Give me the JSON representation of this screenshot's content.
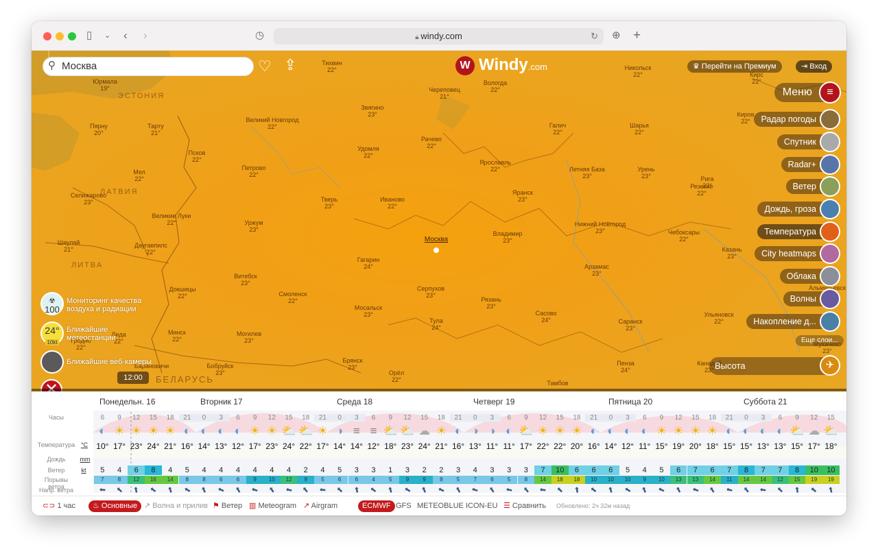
{
  "browser": {
    "url": "windy.com"
  },
  "map": {
    "search_value": "Москва",
    "logo_text": "Windy",
    "logo_domain": ".com",
    "premium": "Перейти на Премиум",
    "login": "Вход",
    "menu": "Меню",
    "layers": [
      "Радар погоды",
      "Спутник",
      "Radar+",
      "Ветер",
      "Дождь, гроза",
      "Температура",
      "City heatmaps",
      "Облака",
      "Волны",
      "Накопление д..."
    ],
    "more_layers": "Еще слои...",
    "altitude": "Высота",
    "time": "12:00",
    "air_quality_value": "100",
    "air_quality_label": "Мониторинг качества воздуха и радиации",
    "nearest_value": "24°",
    "nearest_sub": "10kt",
    "nearest_label": "Ближайшие метеостанции",
    "webcams_label": "Ближайшие веб-камеры",
    "countries": [
      "ЭСТОНИЯ",
      "ЛАТВИЯ",
      "ЛИТВА",
      "БЕЛАРУСЬ"
    ],
    "cities": [
      [
        "Тихвин",
        "22°"
      ],
      [
        "Череповец",
        "21°"
      ],
      [
        "Вологда",
        "22°"
      ],
      [
        "Никольск",
        "22°"
      ],
      [
        "Кирс",
        "22°"
      ],
      [
        "Пярну",
        "20°"
      ],
      [
        "Тарту",
        "21°"
      ],
      [
        "Великий Новгород",
        "22°"
      ],
      [
        "Звягино",
        "23°"
      ],
      [
        "Псков",
        "22°"
      ],
      [
        "Удомля",
        "22°"
      ],
      [
        "Рачево",
        "22°"
      ],
      [
        "Галич",
        "22°"
      ],
      [
        "Шарья",
        "22°"
      ],
      [
        "Киров",
        "22°"
      ],
      [
        "Мел",
        "22°"
      ],
      [
        "Петрово",
        "22°"
      ],
      [
        "Ярославль",
        "22°"
      ],
      [
        "Летняя База",
        "23°"
      ],
      [
        "Урень",
        "23°"
      ],
      [
        "Рига",
        "22°"
      ],
      [
        "Селижарово",
        "23°"
      ],
      [
        "Тверь",
        "23°"
      ],
      [
        "Иваново",
        "22°"
      ],
      [
        "Яранск",
        "23°"
      ],
      [
        "Резекне",
        "22°"
      ],
      [
        "Великие Луки",
        "22°"
      ],
      [
        "Уржум",
        "23°"
      ],
      [
        "Москва",
        ""
      ],
      [
        "Владимир",
        "23°"
      ],
      [
        "Нижний Новгород",
        "23°"
      ],
      [
        "Чебоксары",
        "22°"
      ],
      [
        "Шяуляй",
        "21°"
      ],
      [
        "Даугавпилс",
        "22°"
      ],
      [
        "Гагарин",
        "24°"
      ],
      [
        "Казань",
        "23°"
      ],
      [
        "Витебск",
        "23°"
      ],
      [
        "Арзамас",
        "23°"
      ],
      [
        "Серпухов",
        "23°"
      ],
      [
        "Докшицы",
        "22°"
      ],
      [
        "Смоленск",
        "22°"
      ],
      [
        "Рязань",
        "23°"
      ],
      [
        "Мосальск",
        "23°"
      ],
      [
        "Сасово",
        "24°"
      ],
      [
        "Тула",
        "24°"
      ],
      [
        "Ульяновск",
        "22°"
      ],
      [
        "Саранск",
        "23°"
      ],
      [
        "Минск",
        "22°"
      ],
      [
        "Могилев",
        "23°"
      ],
      [
        "Лида",
        "22°"
      ],
      [
        "Пенза",
        "24°"
      ],
      [
        "Брянск",
        "23°"
      ],
      [
        "Бобруйск",
        "23°"
      ],
      [
        "Канадей",
        "23°"
      ],
      [
        "Орёл",
        "22°"
      ],
      [
        "Барановичи",
        ""
      ],
      [
        "Тамбов",
        ""
      ],
      [
        "Альметьевск",
        ""
      ],
      [
        "Гродно",
        "22°"
      ],
      [
        "Мукачево",
        "23°"
      ],
      [
        "Юрмала",
        "19°"
      ]
    ]
  },
  "forecast": {
    "days": [
      "Понедельн. 16",
      "Вторник 17",
      "Среда 18",
      "Четверг 19",
      "Пятница 20",
      "Суббота 21"
    ],
    "row_labels": {
      "hours": "Часы",
      "temp": "Температура",
      "temp_unit": "°C",
      "rain": "Дождь",
      "rain_unit": "mm",
      "wind": "Ветер",
      "wind_unit": "kt",
      "gusts": "Порывы ветра",
      "dir": "Напр. ветра"
    },
    "hours": [
      "6",
      "9",
      "12",
      "15",
      "18",
      "21",
      "0",
      "3",
      "6",
      "9",
      "12",
      "15",
      "18",
      "21",
      "0",
      "3",
      "6",
      "9",
      "12",
      "15",
      "18",
      "21",
      "0",
      "3",
      "6",
      "9",
      "12",
      "15",
      "18",
      "21",
      "0",
      "3",
      "6",
      "9",
      "12",
      "15",
      "18",
      "21",
      "0",
      "3",
      "6",
      "9",
      "12",
      "15"
    ],
    "temps": [
      "10°",
      "17°",
      "23°",
      "24°",
      "21°",
      "16°",
      "14°",
      "13°",
      "12°",
      "17°",
      "23°",
      "24°",
      "22°",
      "17°",
      "14°",
      "14°",
      "12°",
      "18°",
      "23°",
      "24°",
      "21°",
      "16°",
      "13°",
      "11°",
      "11°",
      "17°",
      "22°",
      "22°",
      "20°",
      "16°",
      "14°",
      "12°",
      "11°",
      "15°",
      "19°",
      "20°",
      "18°",
      "15°",
      "15°",
      "13°",
      "13°",
      "15°",
      "17°",
      "18°"
    ],
    "wind": [
      "5",
      "4",
      "6",
      "8",
      "4",
      "5",
      "4",
      "4",
      "4",
      "4",
      "4",
      "4",
      "2",
      "4",
      "5",
      "3",
      "3",
      "1",
      "3",
      "2",
      "2",
      "3",
      "4",
      "3",
      "3",
      "3",
      "7",
      "10",
      "6",
      "6",
      "6",
      "5",
      "4",
      "5",
      "6",
      "7",
      "6",
      "7",
      "8",
      "7",
      "7",
      "8",
      "10",
      "10"
    ],
    "gusts": [
      "7",
      "8",
      "12",
      "16",
      "14",
      "8",
      "8",
      "6",
      "6",
      "9",
      "10",
      "12",
      "9",
      "5",
      "6",
      "6",
      "4",
      "5",
      "9",
      "9",
      "8",
      "5",
      "7",
      "6",
      "5",
      "8",
      "14",
      "18",
      "18",
      "10",
      "10",
      "10",
      "9",
      "10",
      "13",
      "13",
      "14",
      "11",
      "14",
      "14",
      "12",
      "15",
      "19",
      "19"
    ],
    "icons": [
      "moon",
      "sun",
      "sun",
      "sun",
      "sun",
      "moon",
      "moon",
      "moon",
      "moon",
      "sun",
      "sun",
      "sunc",
      "sunc",
      "sun",
      "moonc",
      "fog",
      "fog",
      "sunc",
      "sunc",
      "cloud",
      "sun",
      "moon",
      "moonc",
      "moonc",
      "moon",
      "sunc",
      "sun",
      "sun",
      "sun",
      "moon",
      "moon",
      "moon",
      "moon",
      "sun",
      "sun",
      "sun",
      "sun",
      "moon",
      "moon",
      "moon",
      "moon",
      "sunc",
      "cloud",
      "sunc"
    ]
  },
  "bottom": {
    "interval": "1 час",
    "tabs": [
      "Основные",
      "Волна и прилив",
      "Ветер",
      "Meteogram",
      "Airgram"
    ],
    "models": [
      "ECMWF",
      "GFS",
      "METEOBLUE",
      "ICON-EU"
    ],
    "compare": "Сравнить",
    "updated": "Обновлено: 2ч 32м назад"
  }
}
